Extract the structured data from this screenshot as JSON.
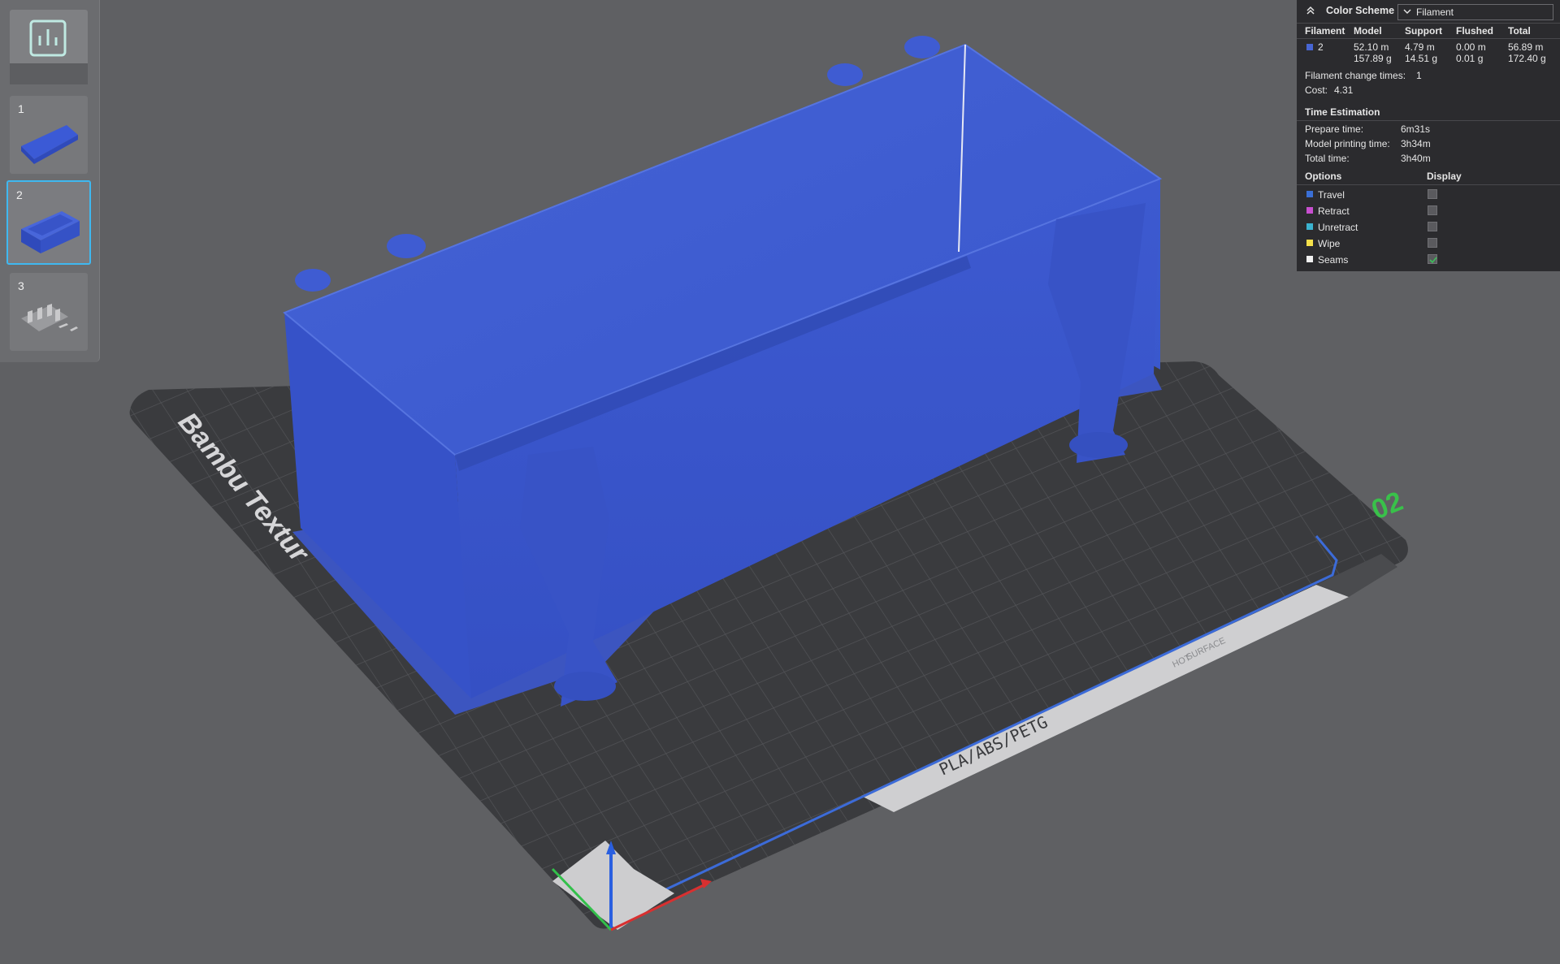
{
  "plates": {
    "slice_button_icon": "bar-chart-icon",
    "items": [
      {
        "number": "1"
      },
      {
        "number": "2"
      },
      {
        "number": "3"
      }
    ],
    "selected": "2"
  },
  "bed": {
    "brand_text": "Bambu Textur",
    "plate_id": "02",
    "material_text": "PLA/ABS/PETG",
    "warning_text_1": "HOT",
    "warning_text_2": "SURFACE"
  },
  "stats_panel": {
    "title": "Color Scheme",
    "scheme_value": "Filament",
    "columns": [
      "Filament",
      "Model",
      "Support",
      "Flushed",
      "Total"
    ],
    "filament_row": {
      "id": "2",
      "color": "#4766d4",
      "model_length": "52.10 m",
      "model_weight": "157.89 g",
      "support_length": "4.79 m",
      "support_weight": "14.51 g",
      "flushed_length": "0.00 m",
      "flushed_weight": "0.01 g",
      "total_length": "56.89 m",
      "total_weight": "172.40 g"
    },
    "change_times_label": "Filament change times:",
    "change_times_value": "1",
    "cost_label": "Cost:",
    "cost_value": "4.31",
    "time_title": "Time Estimation",
    "prepare_label": "Prepare time:",
    "prepare_value": "6m31s",
    "model_time_label": "Model printing time:",
    "model_time_value": "3h34m",
    "total_time_label": "Total time:",
    "total_time_value": "3h40m",
    "options_title": "Options",
    "display_title": "Display",
    "options": [
      {
        "label": "Travel",
        "color": "#3a6fd6",
        "checked": false
      },
      {
        "label": "Retract",
        "color": "#c84fd0",
        "checked": false
      },
      {
        "label": "Unretract",
        "color": "#3bb3d0",
        "checked": false
      },
      {
        "label": "Wipe",
        "color": "#f5e04a",
        "checked": false
      },
      {
        "label": "Seams",
        "color": "#f0f0f0",
        "checked": true
      }
    ]
  }
}
